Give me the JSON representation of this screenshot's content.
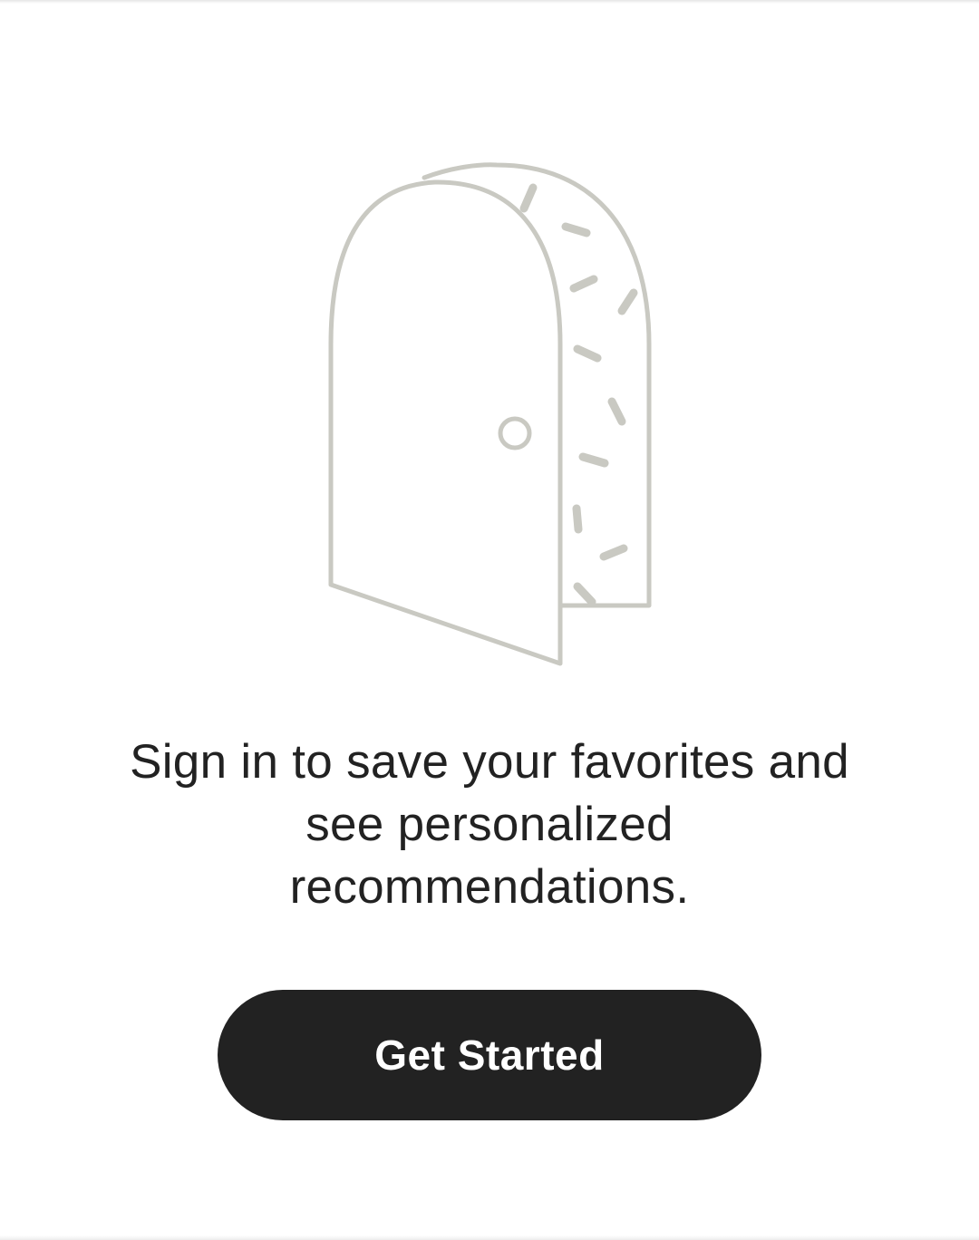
{
  "colors": {
    "background": "#ffffff",
    "text": "#222222",
    "illustration_stroke": "#c9c9c2",
    "button_background": "#222222",
    "button_text": "#ffffff"
  },
  "illustration": {
    "icon": "open-door-icon"
  },
  "message": {
    "line1": "Sign in to save your favorites and",
    "line2": "see personalized",
    "line3": "recommendations."
  },
  "cta": {
    "label": "Get Started"
  }
}
